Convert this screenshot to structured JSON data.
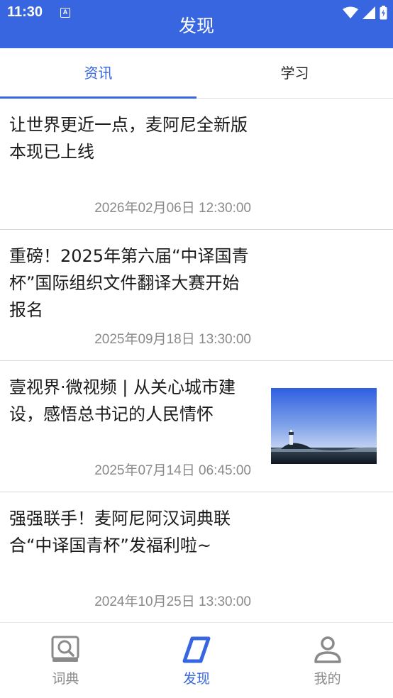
{
  "status_bar": {
    "time": "11:30"
  },
  "header": {
    "title": "发现"
  },
  "tabs": [
    {
      "label": "资讯",
      "active": true
    },
    {
      "label": "学习",
      "active": false
    }
  ],
  "news": [
    {
      "title": "让世界更近一点，麦阿尼全新版本现已上线",
      "date": "2026年02月06日 12:30:00",
      "has_thumbnail": false
    },
    {
      "title": "重磅！2025年第六届“中译国青杯”国际组织文件翻译大赛开始报名",
      "date": "2025年09月18日 13:30:00",
      "has_thumbnail": false
    },
    {
      "title": "壹视界·微视频 | 从关心城市建设，感悟总书记的人民情怀",
      "date": "2025年07月14日 06:45:00",
      "has_thumbnail": true
    },
    {
      "title": "强强联手！麦阿尼阿汉词典联合“中译国青杯”发福利啦~",
      "date": "2024年10月25日 13:30:00",
      "has_thumbnail": false
    }
  ],
  "bottom_nav": [
    {
      "label": "词典",
      "icon": "dictionary-icon",
      "active": false
    },
    {
      "label": "发现",
      "icon": "discover-icon",
      "active": true
    },
    {
      "label": "我的",
      "icon": "profile-icon",
      "active": false
    }
  ],
  "colors": {
    "accent": "#3766e0",
    "muted": "#8a8a8a"
  }
}
